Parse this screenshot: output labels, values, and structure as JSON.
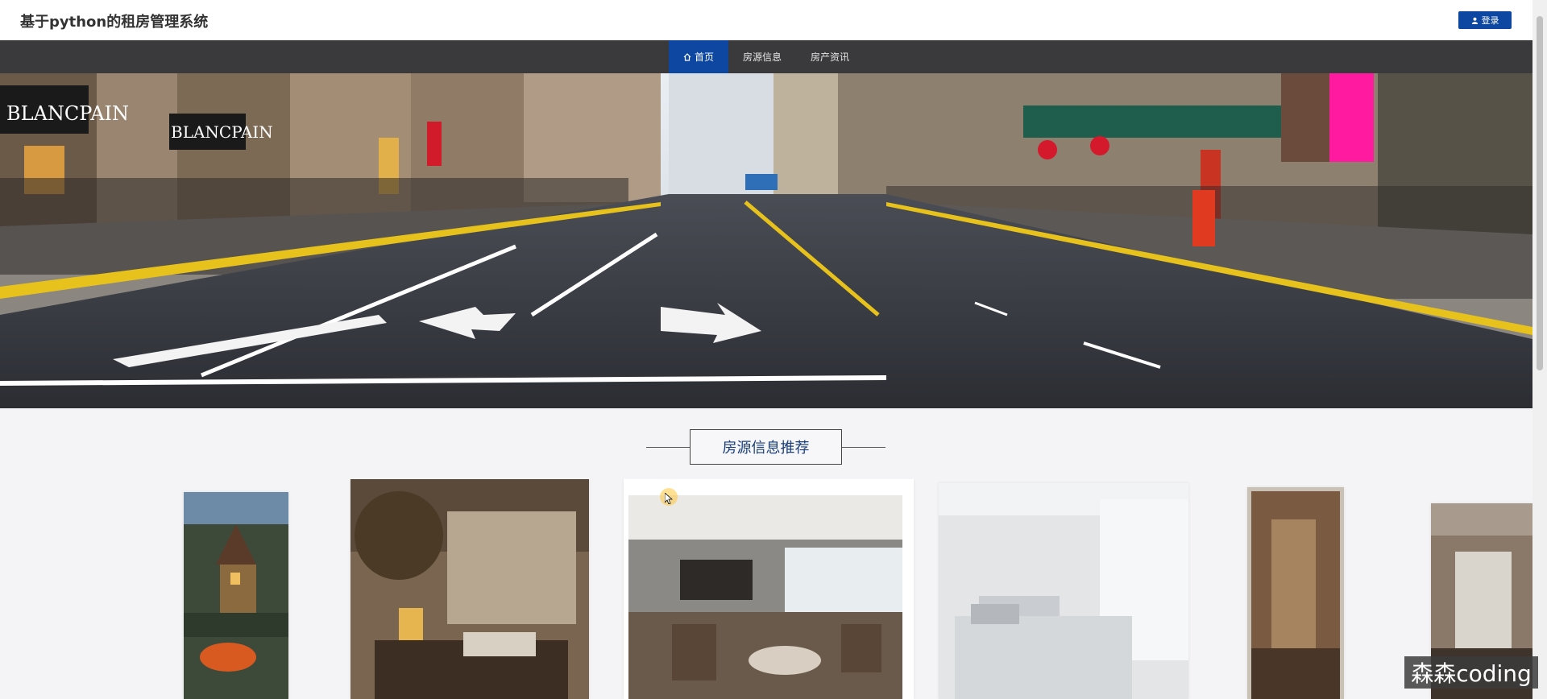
{
  "header": {
    "title": "基于python的租房管理系统",
    "login_label": "登录"
  },
  "nav": {
    "items": [
      {
        "label": "首页",
        "icon": "home-icon",
        "active": true
      },
      {
        "label": "房源信息",
        "icon": "",
        "active": false
      },
      {
        "label": "房产资讯",
        "icon": "",
        "active": false
      }
    ]
  },
  "banner": {
    "description": "city-street-photo",
    "shop_signs": [
      "BLANCPAIN",
      "BLANCPAIN"
    ]
  },
  "section": {
    "title": "房源信息推荐"
  },
  "carousel": {
    "cards": [
      {
        "name": "house-exterior"
      },
      {
        "name": "living-room-plants"
      },
      {
        "name": "hotel-lounge"
      },
      {
        "name": "bedroom-white"
      },
      {
        "name": "room-brown"
      },
      {
        "name": "room-side"
      }
    ]
  },
  "watermark": {
    "text": "森森coding"
  },
  "colors": {
    "primary": "#0d47a1",
    "navbar": "#3a3a3c"
  }
}
